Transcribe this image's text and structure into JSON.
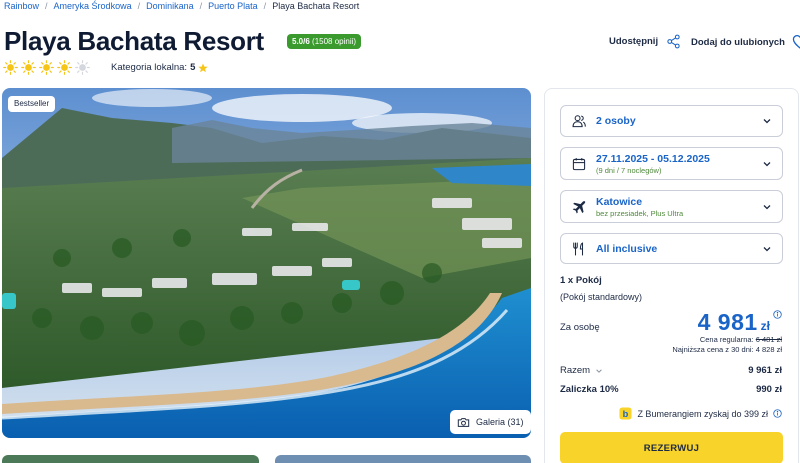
{
  "breadcrumb": [
    {
      "label": "Rainbow"
    },
    {
      "label": "Ameryka Środkowa"
    },
    {
      "label": "Dominikana"
    },
    {
      "label": "Puerto Plata"
    },
    {
      "label": "Playa Bachata Resort"
    }
  ],
  "hotel": {
    "name": "Playa Bachata Resort",
    "rating_score": "5.0/6",
    "rating_count": "(1508 opinii)",
    "suns_filled": 4,
    "suns_total": 5,
    "local_category_label": "Kategoria lokalna:",
    "local_category_value": "5"
  },
  "actions": {
    "share_label": "Udostępnij",
    "favorite_label": "Dodaj do ulubionych"
  },
  "gallery": {
    "badge": "Bestseller",
    "button_label": "Galeria (31)"
  },
  "booking": {
    "persons": {
      "label": "2 osoby",
      "icon": "people-icon"
    },
    "dates": {
      "label": "27.11.2025 - 05.12.2025",
      "sub": "(9 dni / 7 noclegów)",
      "icon": "calendar-icon"
    },
    "departure": {
      "label": "Katowice",
      "sub": "bez przesiadek, Plus Ultra",
      "icon": "plane-icon"
    },
    "board": {
      "label": "All inclusive",
      "icon": "cutlery-icon"
    },
    "room_title": "1 x Pokój",
    "room_sub": "(Pokój standardowy)",
    "per_person_label": "Za osobę",
    "price": "4 981",
    "currency": "zł",
    "regular_price_label": "Cena regularna:",
    "regular_price": "6 481 zł",
    "lowest_price_text": "Najniższa cena z 30 dni: 4 828 zł",
    "total_label": "Razem",
    "total_value": "9 961 zł",
    "deposit_label": "Zaliczka 10%",
    "deposit_value": "990 zł",
    "boomerang_text": "Z Bumerangiem zyskaj do 399 zł",
    "reserve_label": "REZERWUJ"
  },
  "colors": {
    "accent_blue": "#1a64c8",
    "rating_green": "#3a9a2e",
    "reserve_yellow": "#f8d329",
    "sun_yellow": "#f5c518"
  }
}
